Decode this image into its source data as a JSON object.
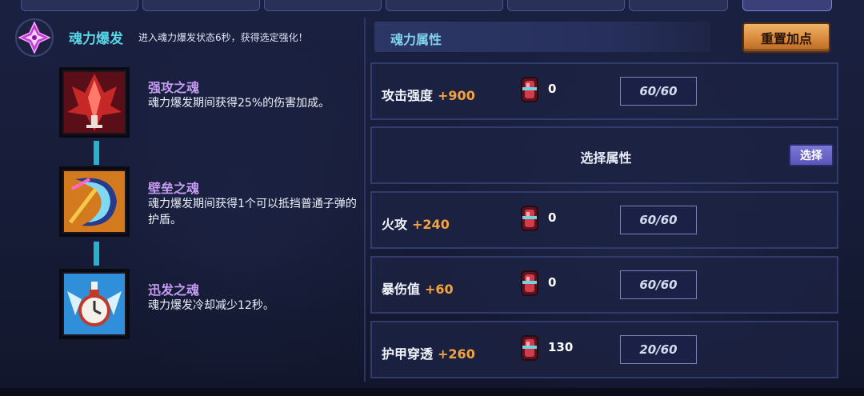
{
  "burst": {
    "title": "魂力爆发",
    "desc": "进入魂力爆发状态6秒，获得选定强化！"
  },
  "skills": [
    {
      "name": "强攻之魂",
      "desc": "魂力爆发期间获得25%的伤害加成。",
      "icon": "red-ship-icon"
    },
    {
      "name": "壁垒之魂",
      "desc": "魂力爆发期间获得1个可以抵挡普通子弹的护盾。",
      "icon": "shield-crescent-icon"
    },
    {
      "name": "迅发之魂",
      "desc": "魂力爆发冷却减少12秒。",
      "icon": "timer-wings-icon"
    }
  ],
  "attributes": {
    "header": "魂力属性",
    "reset_label": "重置加点",
    "select_row_label": "选择属性",
    "select_button": "选择",
    "rows": [
      {
        "name": "攻击强度",
        "bonus": "+900",
        "gems": "0",
        "level": "60/60"
      },
      {
        "name": "火攻",
        "bonus": "+240",
        "gems": "0",
        "level": "60/60"
      },
      {
        "name": "暴伤值",
        "bonus": "+60",
        "gems": "0",
        "level": "60/60"
      },
      {
        "name": "护甲穿透",
        "bonus": "+260",
        "gems": "130",
        "level": "20/60"
      }
    ]
  },
  "colors": {
    "burst_title": "#58d6e6",
    "skill_title": "#c39bf0",
    "bonus": "#f5a33c",
    "reset_button": "#d9893c",
    "select_button": "#5a55b8"
  }
}
